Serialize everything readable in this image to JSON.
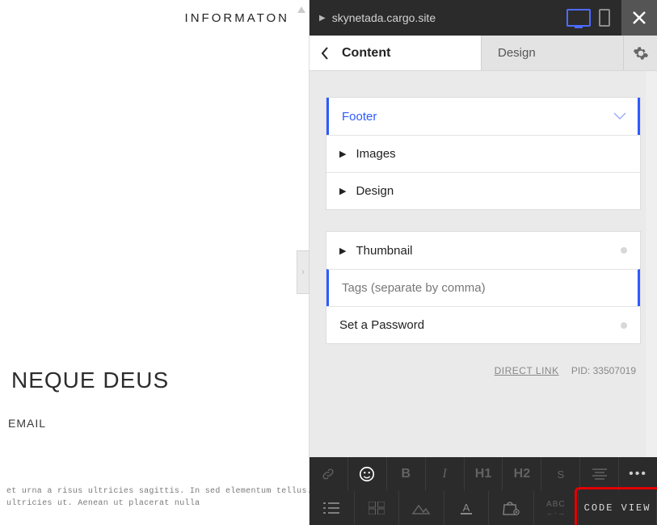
{
  "preview": {
    "top_right": "INFORMATON",
    "headline": "NEQUE DEUS",
    "subhead": "EMAIL",
    "lorem": "et urna a risus ultricies sagittis. In sed elementum tellus.\nultricies ut. Aenean ut placerat nulla"
  },
  "topbar": {
    "url": "skynetada.cargo.site"
  },
  "tabs": {
    "content": "Content",
    "design": "Design"
  },
  "sections": {
    "footer": "Footer",
    "images": "Images",
    "design": "Design",
    "thumbnail": "Thumbnail",
    "tags_placeholder": "Tags (separate by comma)",
    "password": "Set a Password"
  },
  "meta": {
    "direct_link": "DIRECT LINK",
    "pid_label": "PID:",
    "pid_value": "33507019"
  },
  "toolbar1": {
    "bold": "B",
    "italic": "I",
    "h1": "H1",
    "h2": "H2",
    "small": "S",
    "more": "•••"
  },
  "toolbar2": {
    "abc": "ABC",
    "arrows": "←·→",
    "code_view": "CODE VIEW"
  }
}
